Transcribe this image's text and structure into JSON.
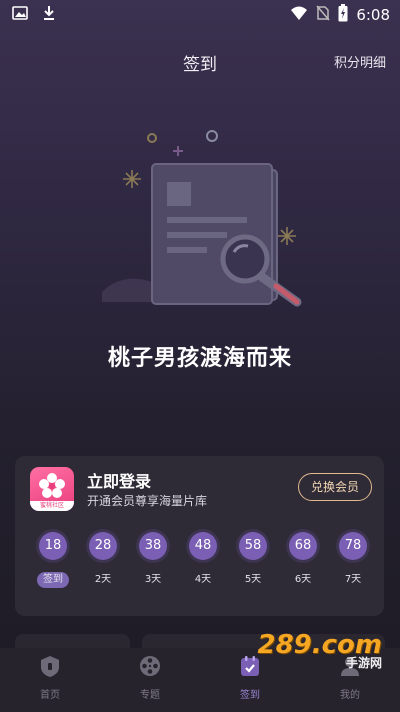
{
  "status_bar": {
    "time": "6:08"
  },
  "header": {
    "title": "签到",
    "points_detail": "积分明细"
  },
  "slogan": "桃子男孩渡海而来",
  "login_card": {
    "app_icon_caption": "蜜桃社区",
    "title": "立即登录",
    "subtitle": "开通会员尊享海量片库",
    "redeem_label": "兑换会员",
    "days": [
      {
        "points": "18",
        "label": "签到",
        "today": true
      },
      {
        "points": "28",
        "label": "2天"
      },
      {
        "points": "38",
        "label": "3天"
      },
      {
        "points": "48",
        "label": "4天"
      },
      {
        "points": "58",
        "label": "5天"
      },
      {
        "points": "68",
        "label": "6天"
      },
      {
        "points": "78",
        "label": "7天"
      }
    ]
  },
  "tabs": [
    {
      "label": "首页",
      "icon": "home-shield-icon"
    },
    {
      "label": "专题",
      "icon": "film-reel-icon"
    },
    {
      "label": "签到",
      "icon": "calendar-check-icon",
      "active": true
    },
    {
      "label": "我的",
      "icon": "user-icon"
    }
  ],
  "watermark": {
    "logo": "289.com",
    "caption": "手游网"
  },
  "colors": {
    "accent": "#7a5fb4",
    "gold": "#e0b98f",
    "active_tab": "#9b86d6"
  }
}
